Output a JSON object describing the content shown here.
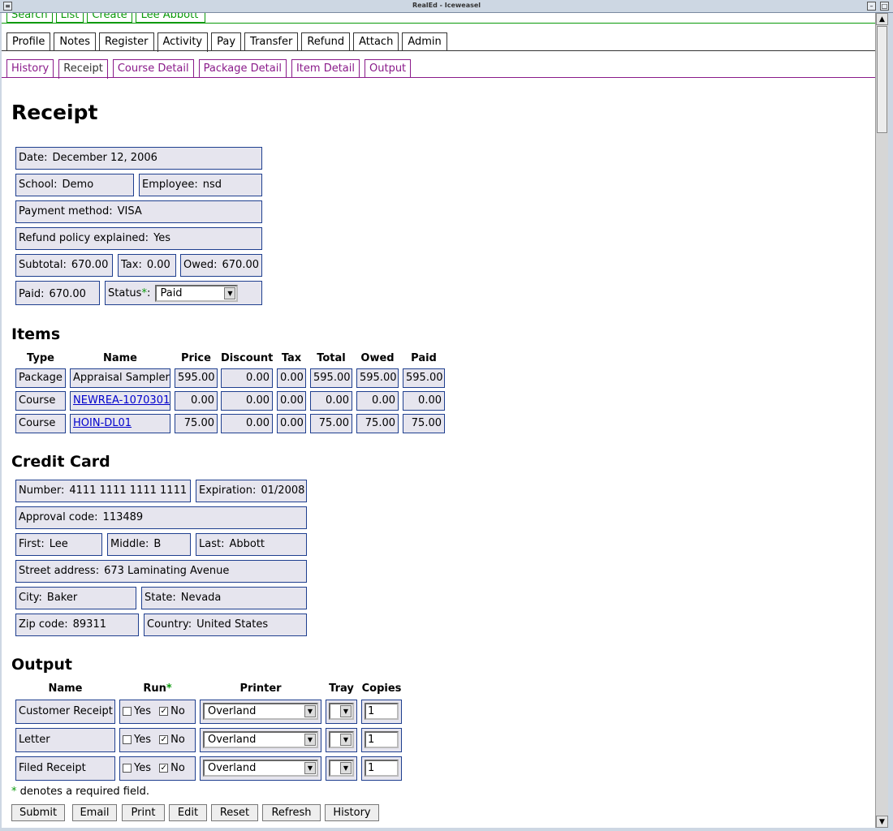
{
  "window": {
    "title": "RealEd - Iceweasel"
  },
  "top_tabs": [
    "Search",
    "List",
    "Create",
    "Lee Abbott"
  ],
  "main_tabs": [
    {
      "label": "Profile"
    },
    {
      "label": "Notes"
    },
    {
      "label": "Register"
    },
    {
      "label": "Activity",
      "active": true
    },
    {
      "label": "Pay"
    },
    {
      "label": "Transfer"
    },
    {
      "label": "Refund"
    },
    {
      "label": "Attach"
    },
    {
      "label": "Admin"
    }
  ],
  "sub_tabs": [
    {
      "label": "History"
    },
    {
      "label": "Receipt",
      "active": true
    },
    {
      "label": "Course Detail"
    },
    {
      "label": "Package Detail"
    },
    {
      "label": "Item Detail"
    },
    {
      "label": "Output"
    }
  ],
  "page_title": "Receipt",
  "receipt": {
    "date": {
      "label": "Date:",
      "value": "December 12, 2006"
    },
    "school": {
      "label": "School:",
      "value": "Demo"
    },
    "employee": {
      "label": "Employee:",
      "value": "nsd"
    },
    "payment_method": {
      "label": "Payment method:",
      "value": "VISA"
    },
    "refund_policy": {
      "label": "Refund policy explained:",
      "value": "Yes"
    },
    "subtotal": {
      "label": "Subtotal:",
      "value": "670.00"
    },
    "tax": {
      "label": "Tax:",
      "value": "0.00"
    },
    "owed": {
      "label": "Owed:",
      "value": "670.00"
    },
    "paid": {
      "label": "Paid:",
      "value": "670.00"
    },
    "status": {
      "label": "Status",
      "required": "*",
      "colon": ":",
      "value": "Paid"
    }
  },
  "items": {
    "heading": "Items",
    "columns": [
      "Type",
      "Name",
      "Price",
      "Discount",
      "Tax",
      "Total",
      "Owed",
      "Paid"
    ],
    "rows": [
      {
        "type": "Package",
        "name": "Appraisal Sampler",
        "link": false,
        "price": "595.00",
        "discount": "0.00",
        "tax": "0.00",
        "total": "595.00",
        "owed": "595.00",
        "paid": "595.00"
      },
      {
        "type": "Course",
        "name": "NEWREA-1070301",
        "link": true,
        "price": "0.00",
        "discount": "0.00",
        "tax": "0.00",
        "total": "0.00",
        "owed": "0.00",
        "paid": "0.00"
      },
      {
        "type": "Course",
        "name": "HOIN-DL01",
        "link": true,
        "price": "75.00",
        "discount": "0.00",
        "tax": "0.00",
        "total": "75.00",
        "owed": "75.00",
        "paid": "75.00"
      }
    ]
  },
  "credit_card": {
    "heading": "Credit Card",
    "number": {
      "label": "Number:",
      "value": "4111 1111 1111 1111"
    },
    "expiration": {
      "label": "Expiration:",
      "value": "01/2008"
    },
    "approval": {
      "label": "Approval code:",
      "value": "113489"
    },
    "first": {
      "label": "First:",
      "value": "Lee"
    },
    "middle": {
      "label": "Middle:",
      "value": "B"
    },
    "last": {
      "label": "Last:",
      "value": "Abbott"
    },
    "street": {
      "label": "Street address:",
      "value": "673 Laminating Avenue"
    },
    "city": {
      "label": "City:",
      "value": "Baker"
    },
    "state": {
      "label": "State:",
      "value": "Nevada"
    },
    "zip": {
      "label": "Zip code:",
      "value": "89311"
    },
    "country": {
      "label": "Country:",
      "value": "United States"
    }
  },
  "output": {
    "heading": "Output",
    "columns": {
      "name": "Name",
      "run": "Run",
      "run_req": "*",
      "printer": "Printer",
      "tray": "Tray",
      "copies": "Copies"
    },
    "yes_label": "Yes",
    "no_label": "No",
    "rows": [
      {
        "name": "Customer Receipt",
        "yes": false,
        "no": true,
        "printer": "Overland",
        "tray": "",
        "copies": "1"
      },
      {
        "name": "Letter",
        "yes": false,
        "no": true,
        "printer": "Overland",
        "tray": "",
        "copies": "1"
      },
      {
        "name": "Filed Receipt",
        "yes": false,
        "no": true,
        "printer": "Overland",
        "tray": "",
        "copies": "1"
      }
    ]
  },
  "required_note": {
    "star": "*",
    "text": " denotes a required field."
  },
  "buttons": [
    "Submit",
    "Email",
    "Print",
    "Edit",
    "Reset",
    "Refresh",
    "History"
  ]
}
